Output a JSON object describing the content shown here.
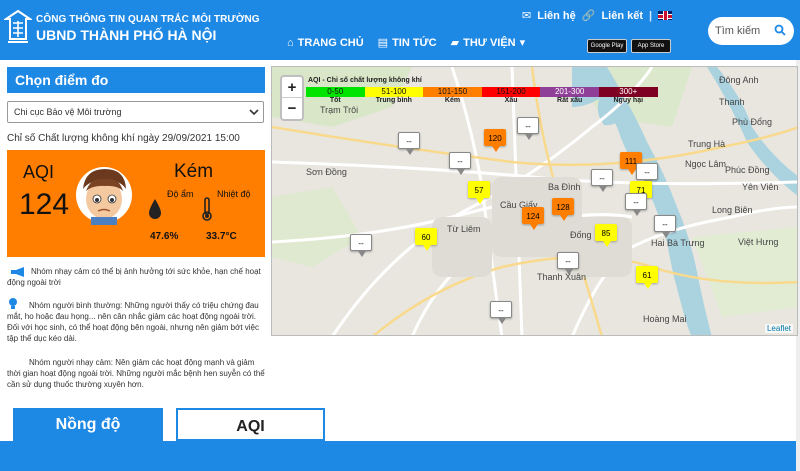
{
  "header": {
    "org_line1": "CÔNG THÔNG TIN QUAN TRẮC MÔI TRƯỜNG",
    "org_line2": "UBND THÀNH PHỐ HÀ NỘI",
    "contact": "Liên hệ",
    "links": "Liên kết",
    "nav": [
      {
        "label": "TRANG CHỦ",
        "icon": "home-icon"
      },
      {
        "label": "TIN TỨC",
        "icon": "newspaper-icon"
      },
      {
        "label": "THƯ VIỆN",
        "icon": "folder-icon"
      }
    ],
    "google_play": "Google Play",
    "app_store": "App Store",
    "search_placeholder": "Tìm kiếm"
  },
  "panel": {
    "title": "Chọn điểm đo",
    "station": "Chi cục Bảo vệ Môi trường",
    "time_text": "Chỉ số Chất lượng không khí ngày 29/09/2021 15:00",
    "aqi_label": "AQI",
    "aqi_value": "124",
    "aqi_status": "Kém",
    "aqi_color": "#ff7e00",
    "humidity_label": "Độ ẩm",
    "humidity_value": "47.6%",
    "temp_label": "Nhiệt độ",
    "temp_value": "33.7°C"
  },
  "advice": {
    "sensitive_short": "Nhóm nhạy cảm có thể bị ảnh hưởng tới sức khỏe, hạn chế hoạt động ngoài trời",
    "normal": "Nhóm người bình thường: Những người thấy có triệu chứng đau mắt, ho hoặc đau họng... nên cân nhắc giảm các hoạt động ngoài trời. Đối với học sinh, có thể hoạt động bên ngoài, nhưng nên giảm bớt việc tập thể dục kéo dài.",
    "sensitive": "Nhóm người nhạy cảm: Nên giảm các hoạt động mạnh và giảm thời gian hoạt động ngoài trời. Những người mắc bệnh hen suyễn có thể cần sử dụng thuốc thường xuyên hơn."
  },
  "tabs": {
    "concentration": "Nồng độ",
    "aqi": "AQI"
  },
  "map": {
    "zoom_in": "+",
    "zoom_out": "−",
    "legend_title": "AQI - Chỉ số chất lượng không khí",
    "legend": [
      {
        "range": "0-50",
        "label": "Tốt",
        "color": "#00e400"
      },
      {
        "range": "51-100",
        "label": "Trung bình",
        "color": "#ffff00"
      },
      {
        "range": "101-150",
        "label": "Kém",
        "color": "#ff7e00"
      },
      {
        "range": "151-200",
        "label": "Xấu",
        "color": "#ff0000"
      },
      {
        "range": "201-300",
        "label": "Rất xấu",
        "color": "#8f3f97"
      },
      {
        "range": "300+",
        "label": "Nguy hại",
        "color": "#7e0023"
      }
    ],
    "places": [
      "Trạm Trôi",
      "Sơn Đồng",
      "Cầu Giấy",
      "Ba Đình",
      "Từ Liêm",
      "Đống",
      "Thanh Xuân",
      "Hoàng Mai",
      "Thanh",
      "Trung Hà",
      "Ngọc Lâm",
      "Phúc Đồng",
      "Long Biên",
      "Việt Hưng",
      "Hai Bà Trưng",
      "Đông Anh",
      "Phù Đổng",
      "Yên Viên"
    ],
    "markers": [
      {
        "value": "--",
        "color": "#ffffff"
      },
      {
        "value": "--",
        "color": "#ffffff"
      },
      {
        "value": "120",
        "color": "#ff7e00"
      },
      {
        "value": "--",
        "color": "#ffffff"
      },
      {
        "value": "57",
        "color": "#ffff00"
      },
      {
        "value": "124",
        "color": "#ff7e00"
      },
      {
        "value": "128",
        "color": "#ff7e00"
      },
      {
        "value": "--",
        "color": "#ffffff"
      },
      {
        "value": "111",
        "color": "#ff7e00"
      },
      {
        "value": "--",
        "color": "#ffffff"
      },
      {
        "value": "71",
        "color": "#ffff00"
      },
      {
        "value": "--",
        "color": "#ffffff"
      },
      {
        "value": "85",
        "color": "#ffff00"
      },
      {
        "value": "--",
        "color": "#ffffff"
      },
      {
        "value": "60",
        "color": "#ffff00"
      },
      {
        "value": "--",
        "color": "#ffffff"
      },
      {
        "value": "--",
        "color": "#ffffff"
      },
      {
        "value": "61",
        "color": "#ffff00"
      },
      {
        "value": "--",
        "color": "#ffffff"
      }
    ],
    "attribution": "Leaflet"
  }
}
